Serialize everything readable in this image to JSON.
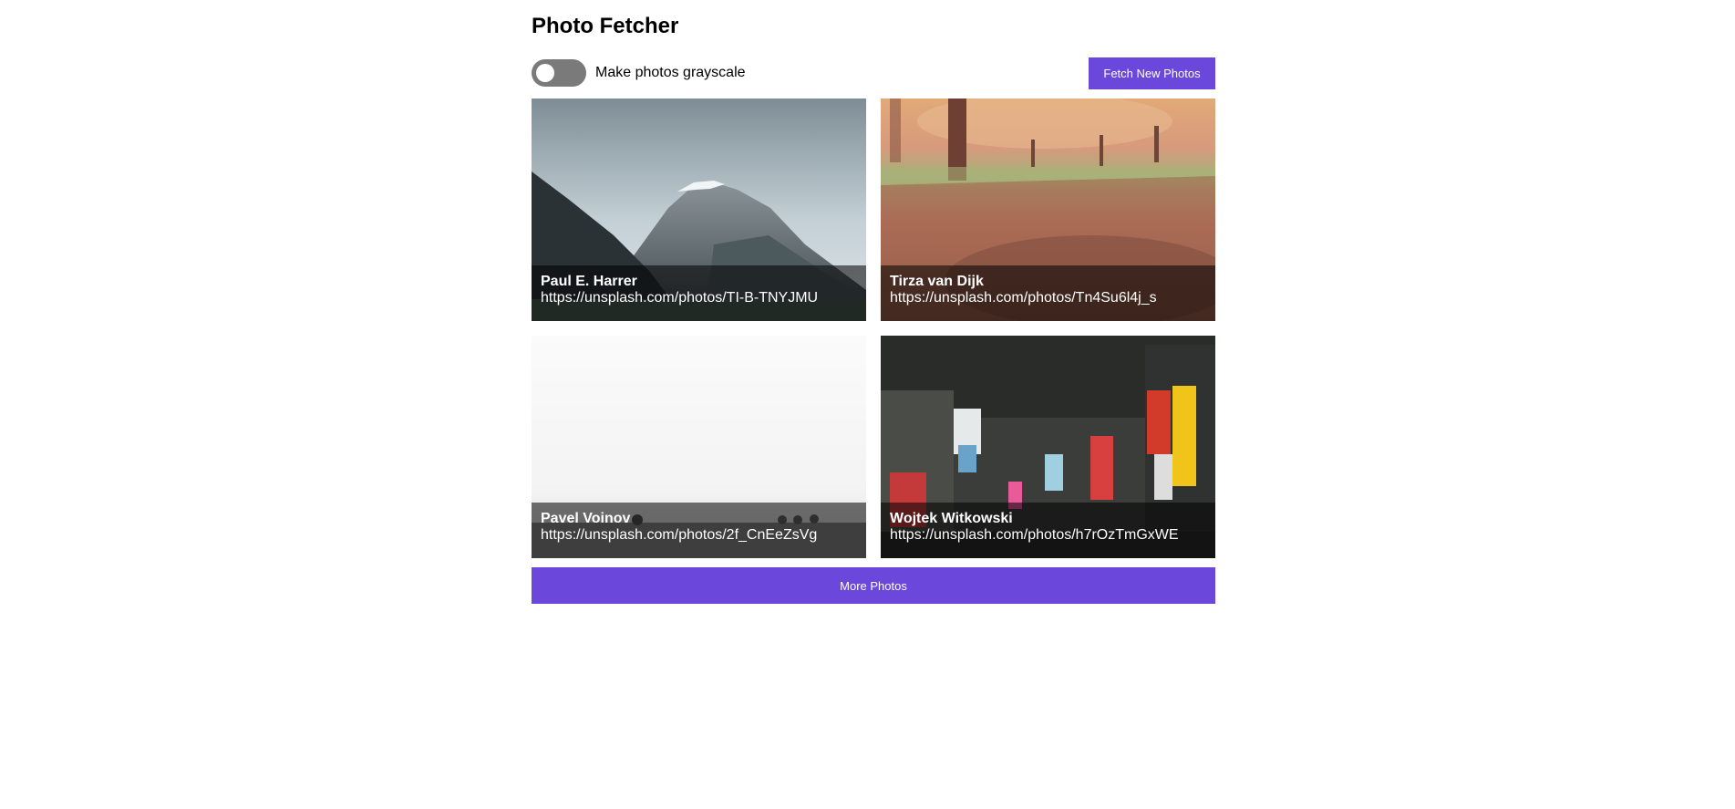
{
  "app": {
    "title": "Photo Fetcher"
  },
  "controls": {
    "grayscale_toggle": {
      "label": "Make photos grayscale",
      "checked": false
    },
    "fetch_button": "Fetch New Photos"
  },
  "photos": [
    {
      "author": "Paul E. Harrer",
      "url": "https://unsplash.com/photos/TI-B-TNYJMU",
      "subject": "mountain"
    },
    {
      "author": "Tirza van Dijk",
      "url": "https://unsplash.com/photos/Tn4Su6l4j_s",
      "subject": "autumn-path"
    },
    {
      "author": "Pavel Voinov",
      "url": "https://unsplash.com/photos/2f_CnEeZsVg",
      "subject": "foggy-field"
    },
    {
      "author": "Wojtek Witkowski",
      "url": "https://unsplash.com/photos/h7rOzTmGxWE",
      "subject": "city-night-signs"
    }
  ],
  "more_button": "More Photos",
  "colors": {
    "accent": "#6b47dc",
    "toggle_off": "#7a7a7a",
    "caption_bg": "rgba(0,0,0,0.55)"
  }
}
